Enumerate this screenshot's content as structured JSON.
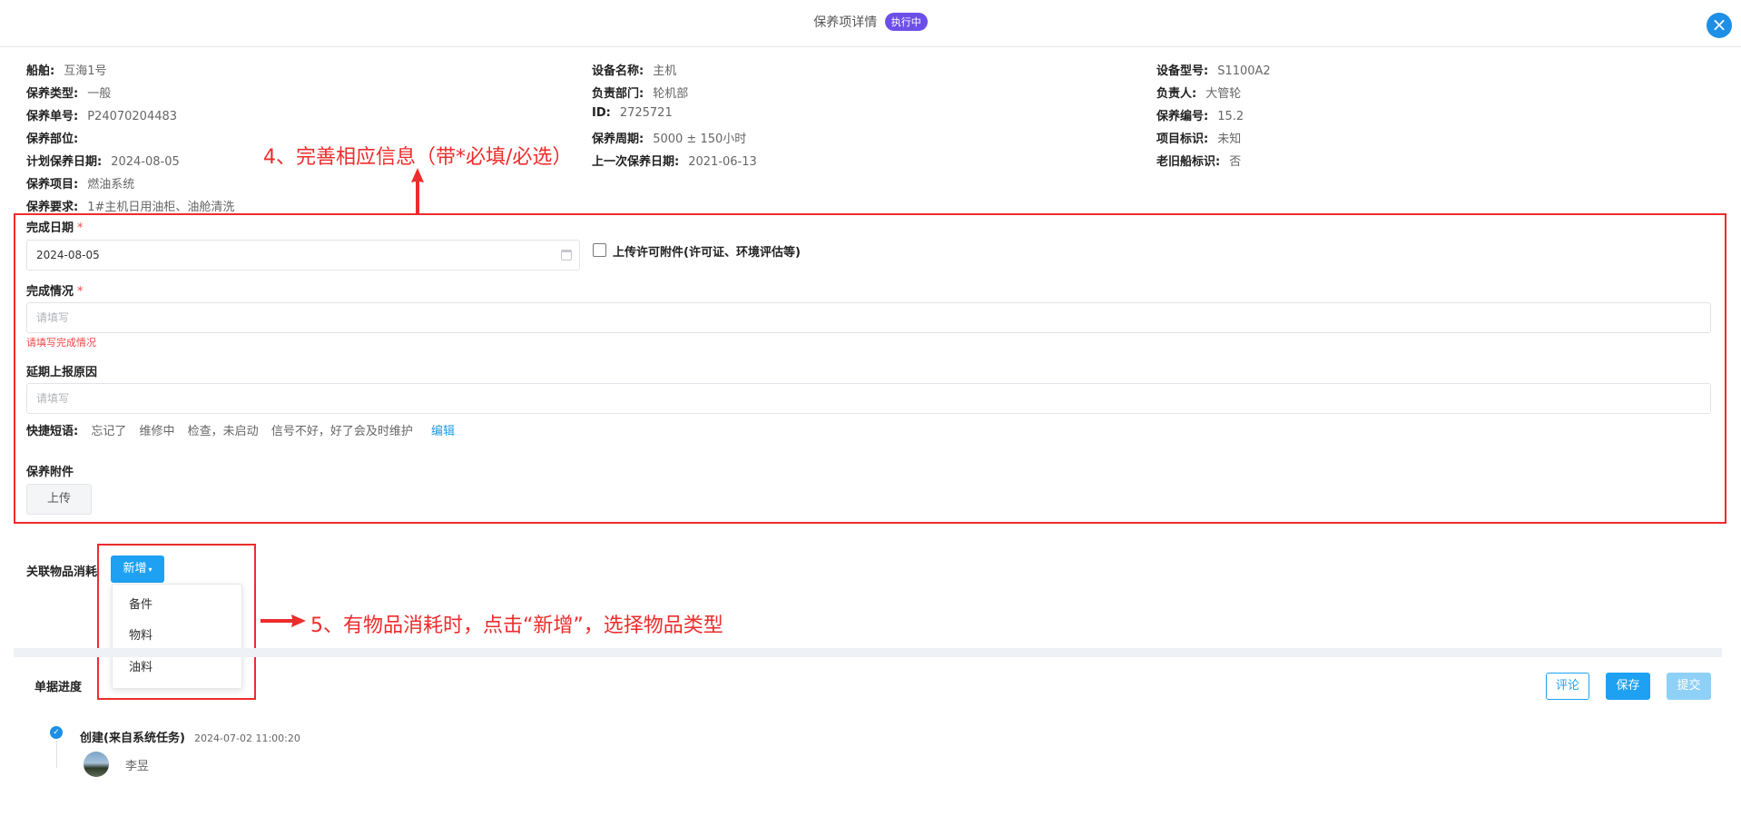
{
  "header": {
    "title": "保养项详情",
    "status_badge": "执行中",
    "close_icon": "close-icon"
  },
  "info": {
    "col1": [
      {
        "label": "船舶:",
        "value": "互海1号"
      },
      {
        "label": "保养类型:",
        "value": "一般"
      },
      {
        "label": "保养单号:",
        "value": "P24070204483"
      },
      {
        "label": "保养部位:",
        "value": ""
      },
      {
        "label": "计划保养日期:",
        "value": "2024-08-05"
      },
      {
        "label": "保养项目:",
        "value": "燃油系统"
      },
      {
        "label": "保养要求:",
        "value": "1#主机日用油柜、油舱清洗"
      }
    ],
    "col2": [
      {
        "label": "设备名称:",
        "value": "主机"
      },
      {
        "label": "负责部门:",
        "value": "轮机部"
      },
      {
        "label": "ID:",
        "value": "2725721"
      },
      {
        "label": "保养周期:",
        "value": "5000 ± 150小时"
      },
      {
        "label": "上一次保养日期:",
        "value": "2021-06-13"
      }
    ],
    "col3": [
      {
        "label": "设备型号:",
        "value": "S1100A2"
      },
      {
        "label": "负责人:",
        "value": "大管轮"
      },
      {
        "label": "保养编号:",
        "value": "15.2"
      },
      {
        "label": "项目标识:",
        "value": "未知"
      },
      {
        "label": "老旧船标识:",
        "value": "否"
      }
    ]
  },
  "annotations": {
    "step4": "4、完善相应信息（带*必填/必选）",
    "step5": "5、有物品消耗时，点击“新增”，选择物品类型"
  },
  "form": {
    "finish_date": {
      "label": "完成日期",
      "required": "*",
      "value": "2024-08-05",
      "icon": "calendar-icon"
    },
    "permit_checkbox": {
      "label": "上传许可附件(许可证、环境评估等)",
      "checked": false
    },
    "finish_status": {
      "label": "完成情况",
      "required": "*",
      "placeholder": "请填写",
      "error": "请填写完成情况"
    },
    "delay_reason": {
      "label": "延期上报原因",
      "placeholder": "请填写"
    },
    "quick_phrases": {
      "label": "快捷短语:",
      "items": [
        "忘记了",
        "维修中",
        "检查，未启动",
        "信号不好，好了会及时维护"
      ],
      "edit": "编辑"
    },
    "attachments": {
      "label": "保养附件",
      "upload": "上传"
    }
  },
  "consumption": {
    "label": "关联物品消耗",
    "add_button": "新增",
    "menu": [
      "备件",
      "物料",
      "油料"
    ]
  },
  "progress": {
    "label": "单据进度",
    "buttons": {
      "comment": "评论",
      "save": "保存",
      "submit": "提交"
    },
    "entries": [
      {
        "title": "创建(来自系统任务)",
        "time": "2024-07-02 11:00:20",
        "user": "李昱"
      }
    ]
  }
}
